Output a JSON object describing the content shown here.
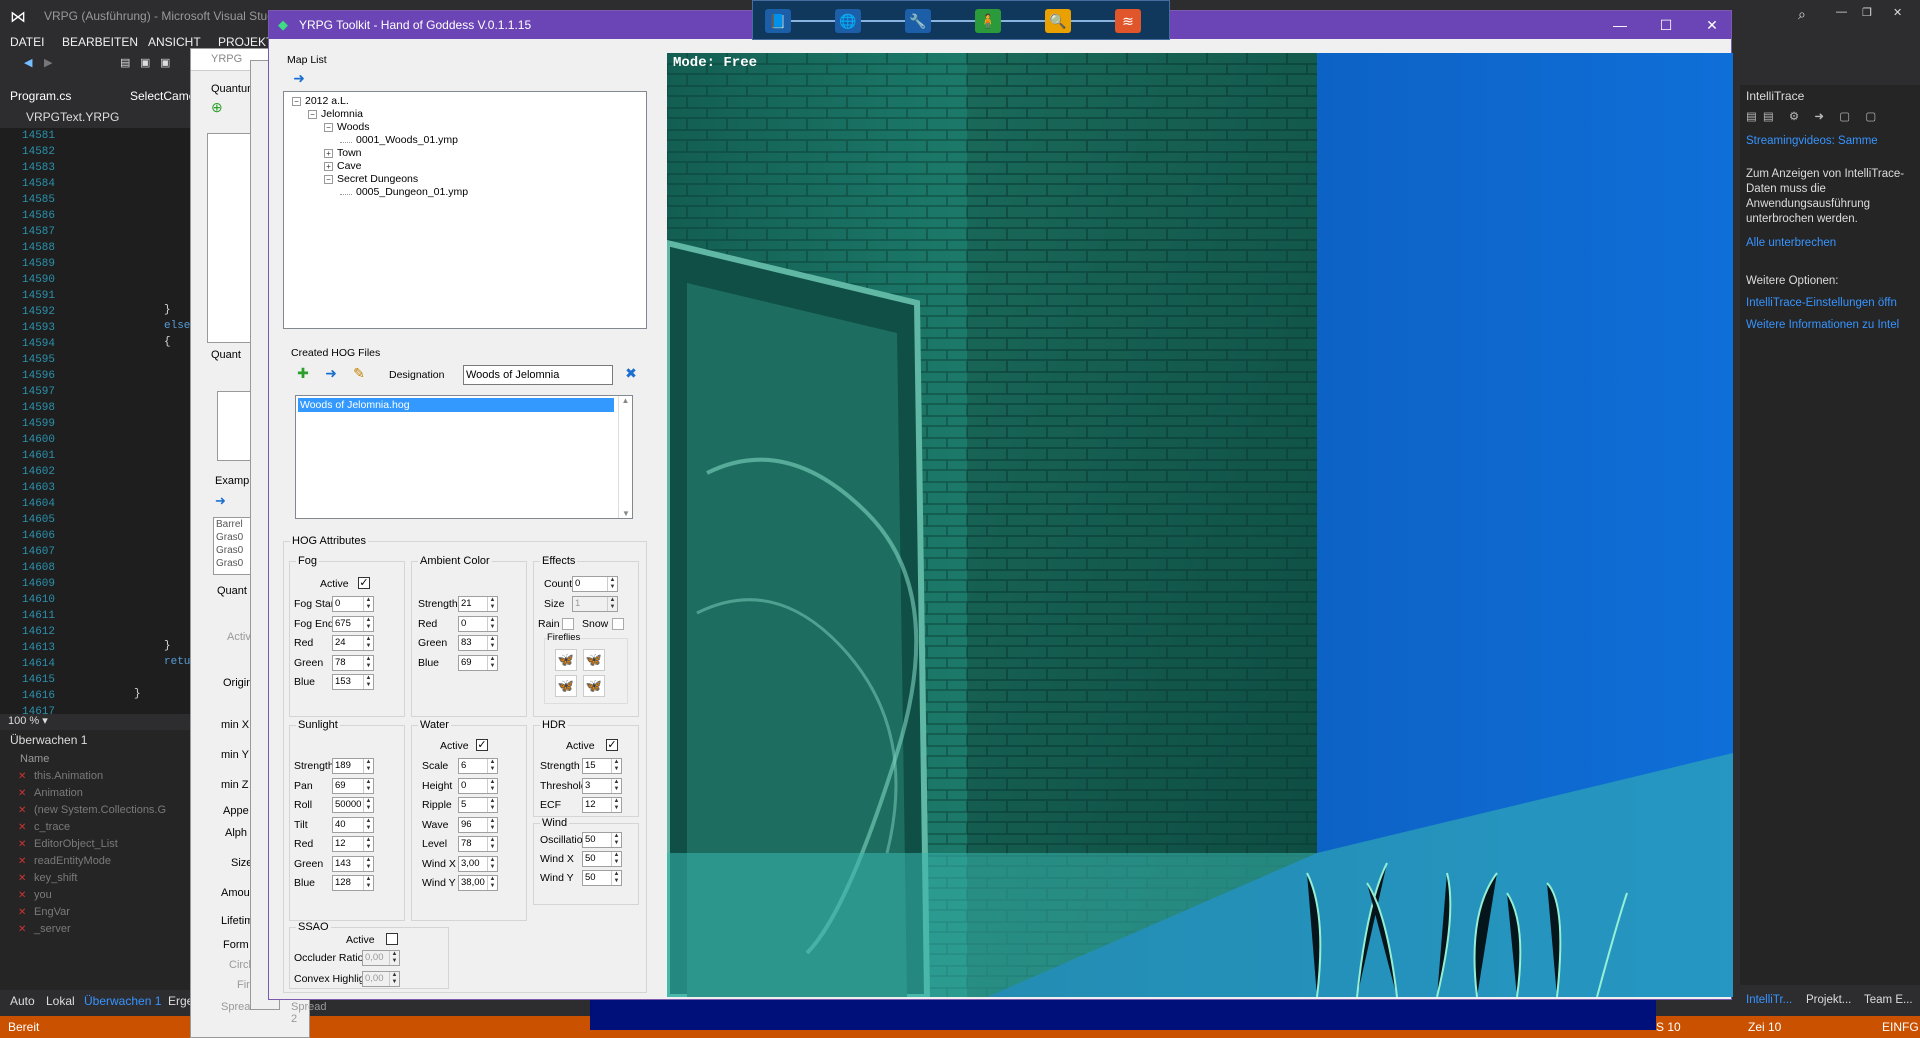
{
  "vs": {
    "title": "VRPG (Ausführung) - Microsoft Visual Studio",
    "menu": [
      "DATEI",
      "BEARBEITEN",
      "ANSICHT",
      "PROJEKT"
    ],
    "tabs": [
      "Program.cs",
      "SelectCame"
    ],
    "file": "VRPGText.YRPG",
    "lines": [
      "14581",
      "14582",
      "14583",
      "14584",
      "14585",
      "14586",
      "14587",
      "14588",
      "14589",
      "14590",
      "14591",
      "14592",
      "14593",
      "14594",
      "14595",
      "14596",
      "14597",
      "14598",
      "14599",
      "14600",
      "14601",
      "14602",
      "14603",
      "14604",
      "14605",
      "14606",
      "14607",
      "14608",
      "14609",
      "14610",
      "14611",
      "14612",
      "14613",
      "14614",
      "14615",
      "14616",
      "14617"
    ],
    "code_else": "else",
    "code_ret": "retu",
    "zoom": "100 %",
    "watch_title": "Überwachen 1",
    "watch_col": "Name",
    "watch_items": [
      "this.Animation",
      "Animation",
      "(new System.Collections.G",
      "c_trace",
      "EditorObject_List",
      "readEntityMode",
      "key_shift",
      "you",
      "EngVar",
      "_server"
    ],
    "bottom_tabs": [
      "Auto",
      "Lokal",
      "Überwachen 1",
      "Erge"
    ],
    "status_left": "Bereit",
    "status_col": "S 10",
    "status_line": "Zei 10",
    "status_ins": "EINFG"
  },
  "intellitrace": {
    "title": "IntelliTrace",
    "streaming": "Streamingvideos: Samme",
    "info": "Zum Anzeigen von IntelliTrace-Daten muss die Anwendungsausführung unterbrochen werden.",
    "break_all": "Alle unterbrechen",
    "more_options": "Weitere Optionen:",
    "settings_link": "IntelliTrace-Einstellungen öffn",
    "more_info_link": "Weitere Informationen zu Intel",
    "bottom_tabs": [
      "IntelliTr...",
      "Projekt...",
      "Team E..."
    ]
  },
  "back_windows": {
    "title": "YRPG",
    "labels": [
      "Quantum",
      "Quant",
      "Examp",
      "Quant",
      "Activ",
      "Origin",
      "min X",
      "min Y",
      "min Z",
      "Appe",
      "Alph",
      "Size",
      "Amount",
      "Lifetime",
      "Form",
      "Circle",
      "Fire",
      "Spread",
      "Spread 2"
    ],
    "example_items": [
      "Barrel",
      "Gras0",
      "Gras0",
      "Gras0"
    ]
  },
  "toolkit": {
    "title": "YRPG Toolkit - Hand of Goddess V.0.1.1.15",
    "toolbar_icons": [
      "book-icon",
      "globe-icon",
      "tools-icon",
      "character-icon",
      "search-icon",
      "water-icon"
    ],
    "toolbar_colors": [
      "#1c5fa8",
      "#1c5fa8",
      "#1c5fa8",
      "#2a9a3a",
      "#e8a100",
      "#e0562a"
    ],
    "map_list_label": "Map List",
    "tree": [
      {
        "label": "2012 a.L.",
        "level": 0
      },
      {
        "label": "Jelomnia",
        "level": 1
      },
      {
        "label": "Woods",
        "level": 2
      },
      {
        "label": "0001_Woods_01.ymp",
        "level": 3
      },
      {
        "label": "Town",
        "level": 2
      },
      {
        "label": "Cave",
        "level": 2
      },
      {
        "label": "Secret Dungeons",
        "level": 2
      },
      {
        "label": "0005_Dungeon_01.ymp",
        "level": 3
      }
    ],
    "hog_files_label": "Created HOG Files",
    "designation_label": "Designation",
    "designation_value": "Woods of Jelomnia",
    "hog_list": [
      "Woods of Jelomnia.hog"
    ],
    "hog_attributes_label": "HOG Attributes",
    "fog": {
      "label": "Fog",
      "active_label": "Active",
      "active": true,
      "fields": [
        [
          "Fog Start",
          "0"
        ],
        [
          "Fog End",
          "675"
        ],
        [
          "Red",
          "24"
        ],
        [
          "Green",
          "78"
        ],
        [
          "Blue",
          "153"
        ]
      ]
    },
    "ambient": {
      "label": "Ambient Color",
      "fields": [
        [
          "Strength",
          "21"
        ],
        [
          "Red",
          "0"
        ],
        [
          "Green",
          "83"
        ],
        [
          "Blue",
          "69"
        ]
      ]
    },
    "effects": {
      "label": "Effects",
      "count_label": "Count",
      "count": "0",
      "size_label": "Size",
      "size": "1",
      "rain_label": "Rain",
      "snow_label": "Snow",
      "fireflies_label": "Fireflies",
      "firefly_colors": [
        "#e02020",
        "#40c040",
        "#e0a000",
        "#2050d0"
      ]
    },
    "sunlight": {
      "label": "Sunlight",
      "fields": [
        [
          "Strength",
          "189"
        ],
        [
          "Pan",
          "69"
        ],
        [
          "Roll",
          "50000"
        ],
        [
          "Tilt",
          "40"
        ],
        [
          "Red",
          "12"
        ],
        [
          "Green",
          "143"
        ],
        [
          "Blue",
          "128"
        ]
      ]
    },
    "water": {
      "label": "Water",
      "active_label": "Active",
      "active": true,
      "fields": [
        [
          "Scale",
          "6"
        ],
        [
          "Height",
          "0"
        ],
        [
          "Ripple",
          "5"
        ],
        [
          "Wave",
          "96"
        ],
        [
          "Level",
          "78"
        ],
        [
          "Wind X",
          "3,00"
        ],
        [
          "Wind Y",
          "38,00"
        ]
      ]
    },
    "hdr": {
      "label": "HDR",
      "active_label": "Active",
      "active": true,
      "fields": [
        [
          "Strength",
          "15"
        ],
        [
          "Threshold",
          "3"
        ],
        [
          "ECF",
          "12"
        ]
      ]
    },
    "wind": {
      "label": "Wind",
      "fields": [
        [
          "Oscillation",
          "50"
        ],
        [
          "Wind X",
          "50"
        ],
        [
          "Wind Y",
          "50"
        ]
      ]
    },
    "ssao": {
      "label": "SSAO",
      "active_label": "Active",
      "active": false,
      "fields": [
        [
          "Occluder Ratio",
          "0,00"
        ],
        [
          "Convex Highlight",
          "0,00"
        ]
      ]
    },
    "viewport_mode": "Mode: Free"
  }
}
